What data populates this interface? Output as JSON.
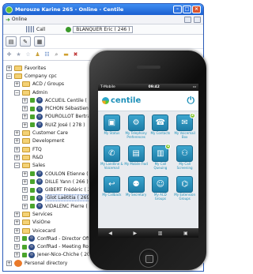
{
  "window": {
    "title": "Merouze Karine 265 - Online - Centile"
  },
  "status": {
    "text": "Online"
  },
  "call": {
    "label": "Call",
    "user": "BLANQUER Eric ( 246 )"
  },
  "tree": {
    "favorites": "Favorites",
    "company": "Company cpc",
    "acd": "ACD / Groups",
    "admin": "Admin",
    "admin_users": [
      "ACCUEIL Centile ( 264 )",
      "PICHON Sébastien ( +33679298...",
      "POUROLLOT Bertrand ( 299 )",
      "RUIZ José ( 278 )"
    ],
    "customer_care": "Customer Care",
    "development": "Development",
    "ftq": "FTQ",
    "rd": "R&D",
    "sales": "Sales",
    "sales_users": [
      "COULON Etienne ( 264 )",
      "DILLE Yann ( 266 )",
      "GIBERT Frédéric ( 262 )",
      "Glot Laëtitia ( 269 )",
      "VIDALENC Pierre ( 142 )"
    ],
    "services": "Services",
    "visiOne": "VisiOne",
    "voicecard": "Voicecard",
    "confrad": [
      "ConfRad - Director Office ( 224 )",
      "ConfRad - Meeting Room ( 205 )",
      "Jener-Nico-Chiche ( 205 )"
    ],
    "personal": "Personal directory"
  },
  "phone": {
    "carrier": "T-Mobile",
    "time": "09:42",
    "brand": "centile",
    "tiles": [
      {
        "label": "My Status",
        "icon": "id-card-icon",
        "glyph": "▣",
        "badge": ""
      },
      {
        "label": "My Telephony Preferences",
        "icon": "gear-phone-icon",
        "glyph": "⚙",
        "badge": ""
      },
      {
        "label": "My Contacts",
        "icon": "contacts-icon",
        "glyph": "☎",
        "badge": ""
      },
      {
        "label": "My Voicemail Box",
        "icon": "voicemail-icon",
        "glyph": "✉",
        "badge": "2"
      },
      {
        "label": "My Landline & Voicemail",
        "icon": "phone-voicemail-icon",
        "glyph": "✆",
        "badge": ""
      },
      {
        "label": "My Mobile Fwd",
        "icon": "mobile-forward-icon",
        "glyph": "▤",
        "badge": ""
      },
      {
        "label": "My Call Queuing",
        "icon": "call-queue-icon",
        "glyph": "▥",
        "badge": "1"
      },
      {
        "label": "My Call Screening",
        "icon": "call-screening-icon",
        "glyph": "⚇",
        "badge": ""
      },
      {
        "label": "My Callback",
        "icon": "callback-icon",
        "glyph": "↩",
        "badge": ""
      },
      {
        "label": "My Secretary",
        "icon": "secretary-icon",
        "glyph": "⚉",
        "badge": ""
      },
      {
        "label": "My ACD Groups",
        "icon": "acd-groups-icon",
        "glyph": "☺",
        "badge": ""
      },
      {
        "label": "My Extension Groups",
        "icon": "extension-groups-icon",
        "glyph": "⌬",
        "badge": ""
      }
    ]
  }
}
